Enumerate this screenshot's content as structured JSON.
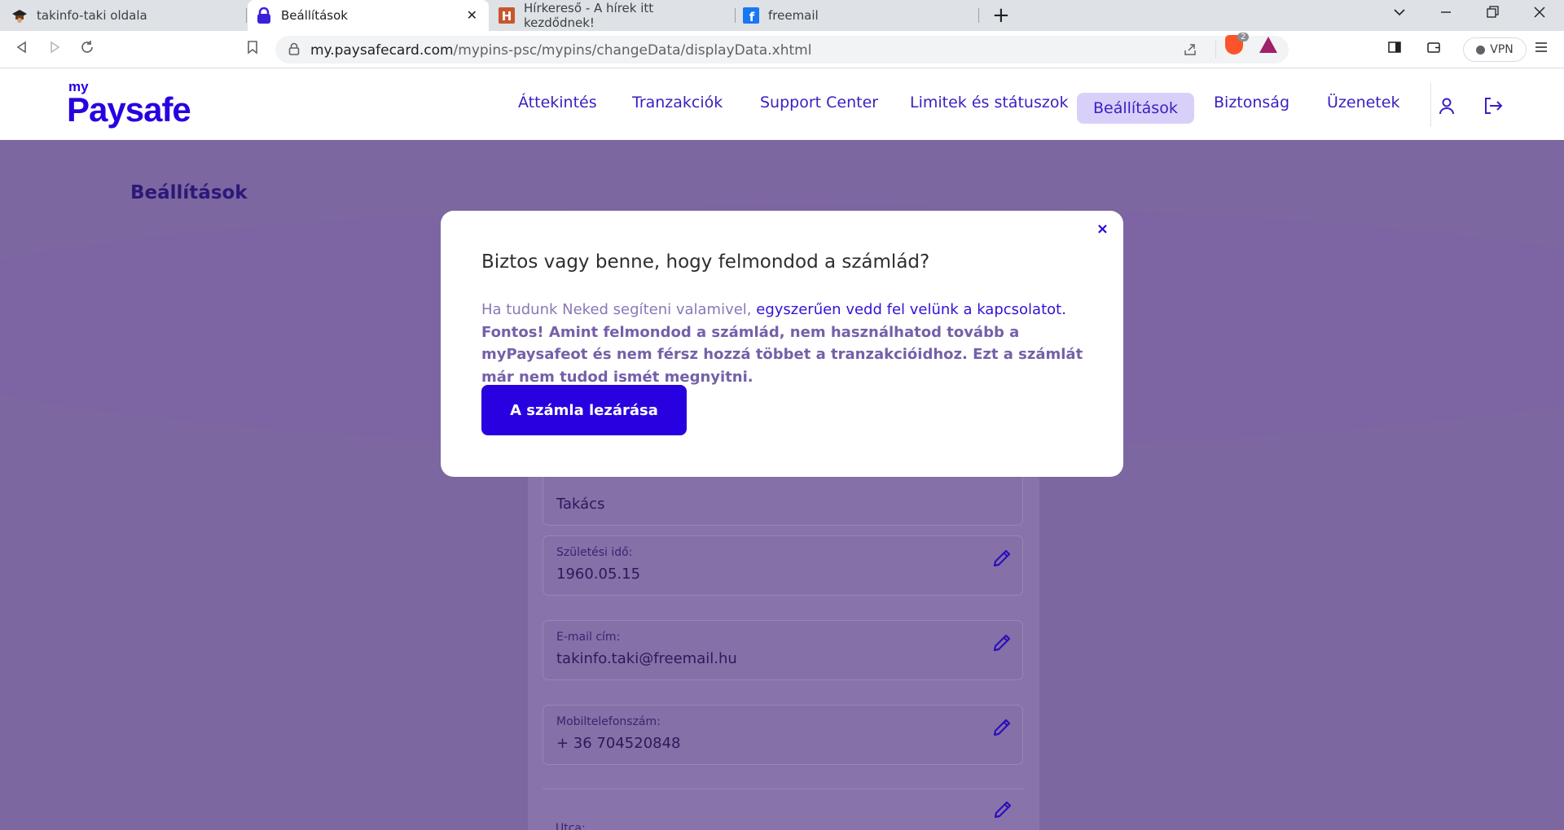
{
  "browser": {
    "tabs": [
      {
        "title": "takinfo-taki oldala",
        "icon": "graduation-cap-icon",
        "active": false
      },
      {
        "title": "Beállítások",
        "icon": "paysafe-lock-icon",
        "active": true
      },
      {
        "title": "Hírkereső - A hírek itt kezdődnek!",
        "icon": "hirkereso-h-icon",
        "active": false
      },
      {
        "title": "freemail",
        "icon": "facebook-f-icon",
        "active": false
      }
    ],
    "url_host": "my.paysafecard.com",
    "url_path": "/mypins-psc/mypins/changeData/displayData.xhtml",
    "shield_count": "2",
    "vpn_label": "VPN"
  },
  "site": {
    "logo_my": "my",
    "logo_main": "Paysafe",
    "nav": [
      "Áttekintés",
      "Tranzakciók",
      "Support Center",
      "Limitek és státuszok",
      "Beállítások",
      "Biztonság",
      "Üzenetek"
    ],
    "active_nav": "Beállítások",
    "page_title": "Beállítások"
  },
  "form": {
    "fields": [
      {
        "label": "",
        "value": "Takács"
      },
      {
        "label": "Születési idő:",
        "value": "1960.05.15"
      },
      {
        "label": "E-mail cím:",
        "value": "takinfo.taki@freemail.hu"
      },
      {
        "label": "Mobiltelefonszám:",
        "value": "+ 36 704520848"
      },
      {
        "label": "Utca:",
        "value": ""
      }
    ]
  },
  "modal": {
    "close": "×",
    "title": "Biztos vagy benne, hogy felmondod a számlád?",
    "body_plain": "Ha tudunk Neked segíteni valamivel, ",
    "body_link": "egyszerűen vedd fel velünk a kapcsolatot.",
    "body_strong": " Fontos! Amint felmondod a számlád, nem használhatod tovább a myPaysafeot és nem férsz hozzá többet a tranzakcióidhoz. Ezt a számlát már nem tudod ismét megnyitni.",
    "button": "A számla lezárása"
  },
  "colors": {
    "brand": "#2900e0",
    "overlay": "#7c67a0",
    "active_nav_bg": "#d9d0fa"
  }
}
